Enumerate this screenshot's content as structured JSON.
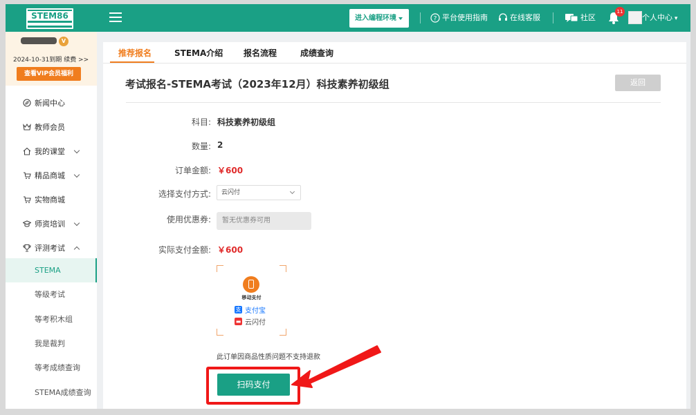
{
  "header": {
    "logo_text": "STEM86",
    "env_button_label": "进入编程环境",
    "guide_label": "平台使用指南",
    "support_label": "在线客服",
    "community_label": "社区",
    "notification_count": "11",
    "user_center_label": "个人中心"
  },
  "vip": {
    "expire_text": "2024-10-31到期",
    "renew_label": "续费 >>",
    "benefits_button": "查看VIP会员福利"
  },
  "sidebar": {
    "items": [
      {
        "label": "新闻中心",
        "icon": "compass-icon"
      },
      {
        "label": "教师会员",
        "icon": "crown-icon"
      },
      {
        "label": "我的课堂",
        "icon": "home-icon"
      },
      {
        "label": "精品商城",
        "icon": "cart-icon"
      },
      {
        "label": "实物商城",
        "icon": "cart-icon"
      },
      {
        "label": "师资培训",
        "icon": "graduation-cap-icon"
      },
      {
        "label": "评测考试",
        "icon": "trophy-icon"
      }
    ],
    "sub_items": [
      {
        "label": "STEMA",
        "active": true
      },
      {
        "label": "等级考试"
      },
      {
        "label": "等考积木组"
      },
      {
        "label": "我是裁判"
      },
      {
        "label": "等考成绩查询"
      },
      {
        "label": "STEMA成绩查询"
      }
    ]
  },
  "tabs": [
    {
      "label": "推荐报名",
      "active": true
    },
    {
      "label": "STEMA介绍"
    },
    {
      "label": "报名流程"
    },
    {
      "label": "成绩查询"
    }
  ],
  "page": {
    "title": "考试报名-STEMA考试（2023年12月）科技素养初级组",
    "back_label": "返回"
  },
  "order": {
    "subject_label": "科目:",
    "subject_value": "科技素养初级组",
    "quantity_label": "数量:",
    "quantity_value": "2",
    "amount_label": "订单金额:",
    "amount_value": "￥600",
    "payment_method_label": "选择支付方式:",
    "payment_method_value": "云闪付",
    "coupon_label": "使用优惠券:",
    "coupon_placeholder": "暂无优惠券可用",
    "actual_amount_label": "实际支付金额:",
    "actual_amount_value": "￥600"
  },
  "qr": {
    "mobile_pay_label": "移动支付",
    "alipay_label": "支付宝",
    "unionpay_label": "云闪付"
  },
  "notice_text": "此订单因商品性质问题不支持退款",
  "pay_button_label": "扫码支付",
  "colors": {
    "brand": "#1aa085",
    "accent": "#f07d1e",
    "price": "#e02b2b",
    "annotation": "#f01818"
  }
}
